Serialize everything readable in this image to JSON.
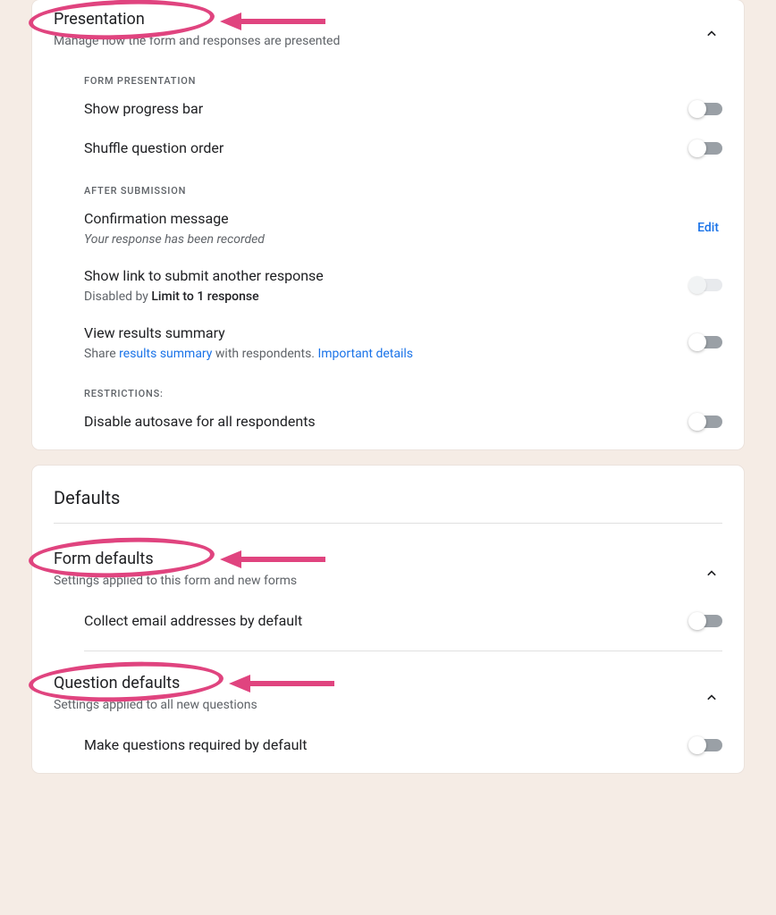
{
  "presentation": {
    "title": "Presentation",
    "subtitle": "Manage how the form and responses are presented",
    "groups": {
      "form_presentation": {
        "label": "FORM PRESENTATION",
        "show_progress_bar": "Show progress bar",
        "shuffle_question_order": "Shuffle question order"
      },
      "after_submission": {
        "label": "AFTER SUBMISSION",
        "confirmation_title": "Confirmation message",
        "confirmation_value": "Your response has been recorded",
        "edit_label": "Edit",
        "show_link_title": "Show link to submit another response",
        "show_link_sub_prefix": "Disabled by ",
        "show_link_sub_bold": "Limit to 1 response",
        "view_results_title": "View results summary",
        "view_results_prefix": "Share ",
        "view_results_link1": "results summary",
        "view_results_mid": " with respondents. ",
        "view_results_link2": "Important details"
      },
      "restrictions": {
        "label": "RESTRICTIONS:",
        "disable_autosave": "Disable autosave for all respondents"
      }
    }
  },
  "defaults": {
    "card_title": "Defaults",
    "form_defaults": {
      "title": "Form defaults",
      "subtitle": "Settings applied to this form and new forms",
      "collect_email": "Collect email addresses by default"
    },
    "question_defaults": {
      "title": "Question defaults",
      "subtitle": "Settings applied to all new questions",
      "make_required": "Make questions required by default"
    }
  }
}
